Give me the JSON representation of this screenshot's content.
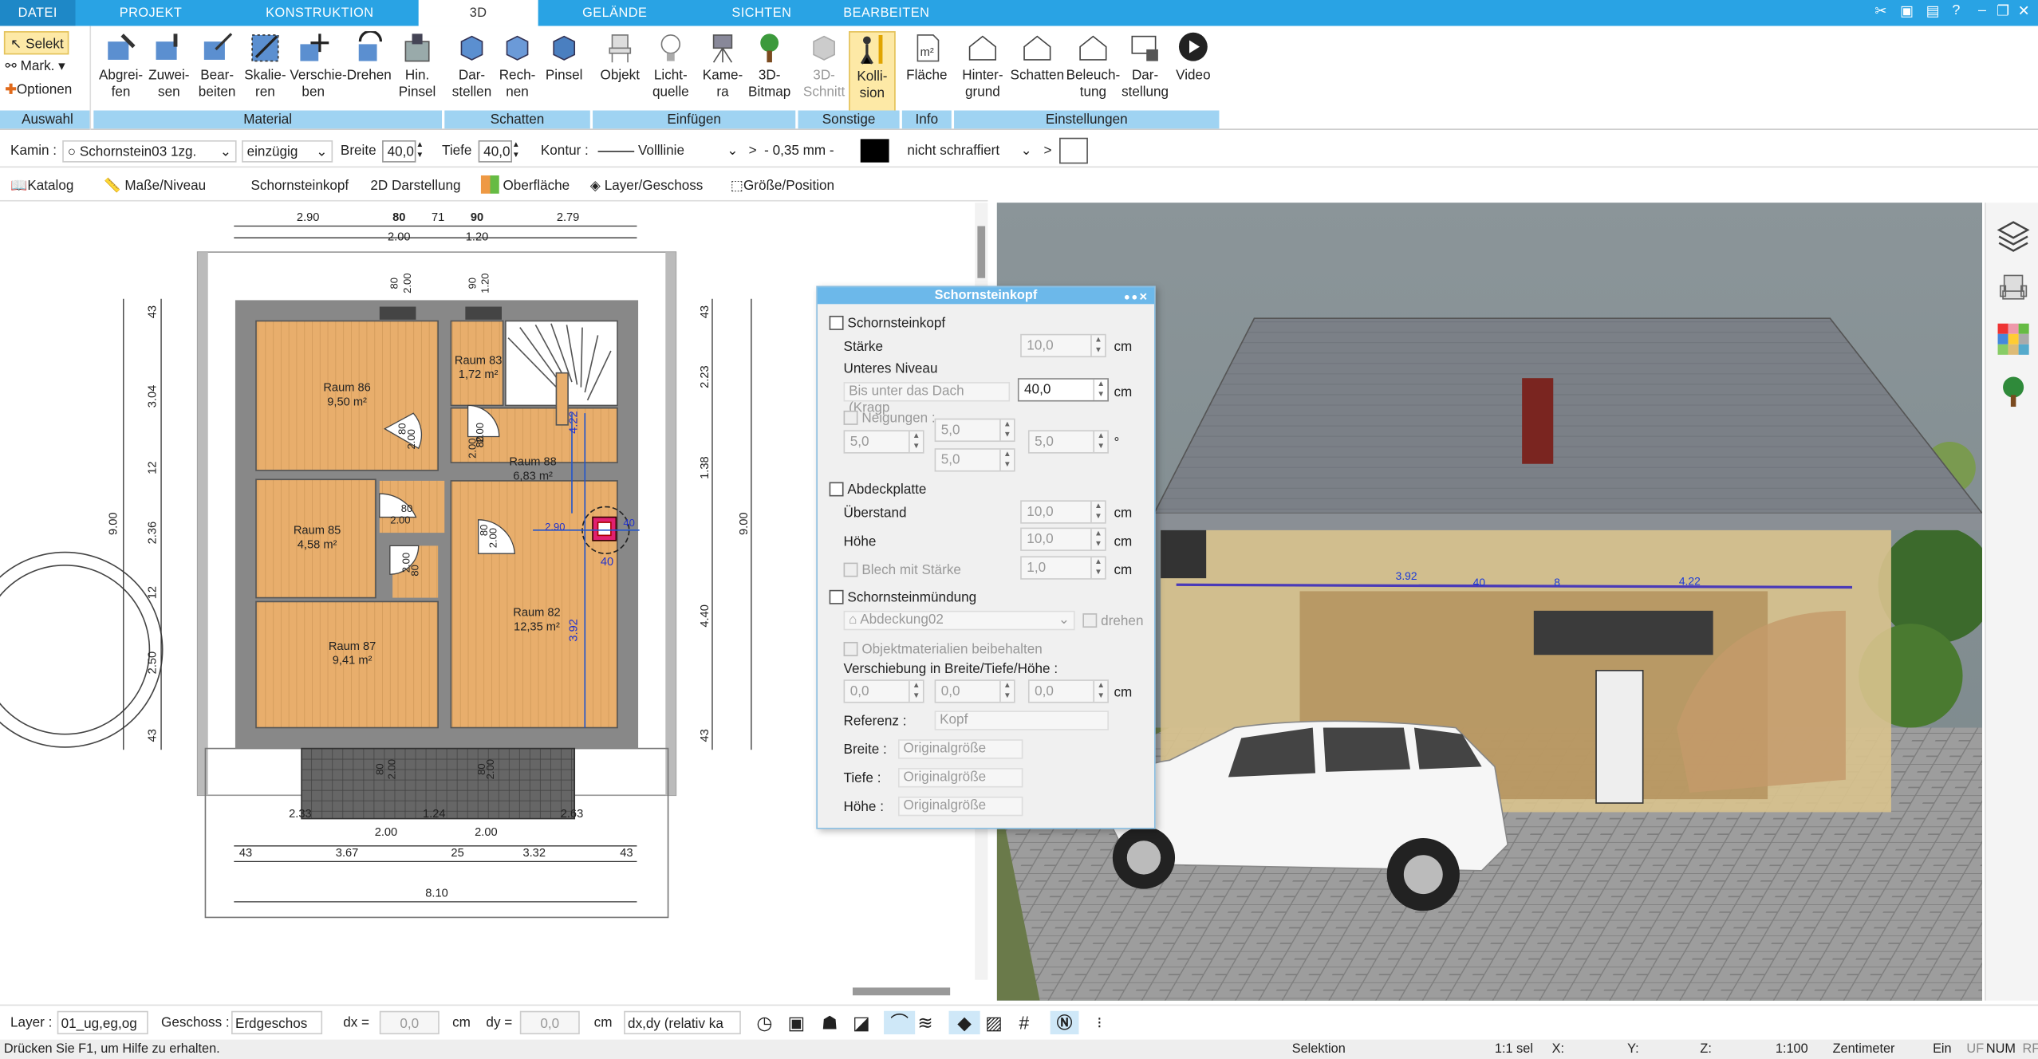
{
  "menu": {
    "tabs": [
      "DATEI",
      "PROJEKT",
      "KONSTRUKTION",
      "3D",
      "GELÄNDE",
      "SICHTEN",
      "BEARBEITEN"
    ]
  },
  "ribbon": {
    "auswahl": {
      "label": "Auswahl",
      "selekt": "Selekt",
      "mark": "Mark.",
      "optionen": "Optionen"
    },
    "material": {
      "label": "Material",
      "buttons": [
        "Abgrei-\nfen",
        "Zuwei-\nsen",
        "Bear-\nbeiten",
        "Skalie-\nren",
        "Verschie-\nben",
        "Drehen",
        "Hin.\nPinsel"
      ]
    },
    "schatten": {
      "label": "Schatten",
      "buttons": [
        "Dar-\nstellen",
        "Rech-\nnen",
        "Pinsel"
      ]
    },
    "einfuegen": {
      "label": "Einfügen",
      "buttons": [
        "Objekt",
        "Licht-\nquelle",
        "Kame-\nra",
        "3D-\nBitmap"
      ]
    },
    "sonstige": {
      "label": "Sonstige",
      "buttons": [
        "3D-\nSchnitt",
        "Kolli-\nsion"
      ]
    },
    "info": {
      "label": "Info",
      "buttons": [
        "Fläche"
      ]
    },
    "einstellungen": {
      "label": "Einstellungen",
      "buttons": [
        "Hinter-\ngrund",
        "Schatten",
        "Beleuch-\ntung",
        "Dar-\nstellung",
        "Video"
      ]
    }
  },
  "propbar": {
    "kamin_label": "Kamin :",
    "kamin_value": "Schornstein03 1zg.",
    "zug": "einzügig",
    "breite_label": "Breite",
    "breite": "40,0",
    "tiefe_label": "Tiefe",
    "tiefe": "40,0",
    "kontur_label": "Kontur :",
    "linie": "Volllinie",
    "gt1": ">",
    "mm": "- 0,35 mm -",
    "schraffur": "nicht schraffiert",
    "gt2": ">"
  },
  "toolbar2": {
    "katalog": "Katalog",
    "masse": "Maße/Niveau",
    "schornsteinkopf": "Schornsteinkopf",
    "darstellung2d": "2D Darstellung",
    "oberflaeche": "Oberfläche",
    "layer": "Layer/Geschoss",
    "groesse": "Größe/Position"
  },
  "plan": {
    "top_dims": [
      "2.90",
      "80",
      "71",
      "90",
      "2.79"
    ],
    "top_dims2": [
      "2.00",
      "1.20"
    ],
    "bottom_dims": [
      "2.33",
      "1.24",
      "2.63"
    ],
    "bottom_dims2": [
      "2.00",
      "2.00"
    ],
    "bottom_dims3": [
      "43",
      "3.67",
      "25",
      "3.32",
      "43"
    ],
    "total": "8.10",
    "left_dims": [
      "43",
      "3.04",
      "12",
      "2.36",
      "12",
      "2.50",
      "43"
    ],
    "left_total": "9.00",
    "right_dims": [
      "43",
      "2.23",
      "1.38",
      "4.40",
      "43"
    ],
    "right_total": "9.00",
    "right_sup": [
      "5",
      "5"
    ],
    "rooms": [
      {
        "name": "Raum 86",
        "area": "9,50 m²"
      },
      {
        "name": "Raum 83",
        "area": "1,72 m²"
      },
      {
        "name": "Raum 88",
        "area": "6,83 m²"
      },
      {
        "name": "Raum 85",
        "area": "4,58 m²"
      },
      {
        "name": "Raum 82",
        "area": "12,35 m²"
      },
      {
        "name": "Raum 87",
        "area": "9,41 m²"
      }
    ],
    "door_labels": [
      "80",
      "2.00",
      "90",
      "1.20",
      "80",
      "2.00",
      "80",
      "2.00",
      "80",
      "2.00",
      "80",
      "2.00",
      "80",
      "2.00",
      "80",
      "2.00",
      "80",
      "2.00",
      "80",
      "2.00"
    ],
    "blue_dims": [
      "4.22",
      "3.92",
      "40",
      "2.90",
      "40"
    ]
  },
  "view3d": {
    "dims": [
      "3.92",
      "40",
      "4.22",
      "8"
    ]
  },
  "dialog": {
    "title": "Schornsteinkopf",
    "cb_schornsteinkopf": "Schornsteinkopf",
    "staerke_label": "Stärke",
    "staerke": "10,0",
    "cm": "cm",
    "unteres_niveau": "Unteres Niveau",
    "niveau_select": "Bis unter das Dach (Kragp",
    "niveau_value": "40,0",
    "neigungen": "Neigungen :",
    "n1": "5,0",
    "n2": "5,0",
    "n3": "5,0",
    "n4": "5,0",
    "deg": "°",
    "cb_abdeckplatte": "Abdeckplatte",
    "ueberstand_label": "Überstand",
    "ueberstand": "10,0",
    "hoehe_label": "Höhe",
    "hoehe": "10,0",
    "blech_label": "Blech mit Stärke",
    "blech": "1,0",
    "cb_muendung": "Schornsteinmündung",
    "abdeckung": "Abdeckung02",
    "drehen": "drehen",
    "objmat": "Objektmaterialien beibehalten",
    "verschiebung": "Verschiebung in Breite/Tiefe/Höhe :",
    "v1": "0,0",
    "v2": "0,0",
    "v3": "0,0",
    "referenz_label": "Referenz :",
    "referenz": "Kopf",
    "breite_label": "Breite :",
    "tiefe_label": "Tiefe :",
    "hoehe2_label": "Höhe :",
    "orig": "Originalgröße"
  },
  "bottombar": {
    "layer_label": "Layer :",
    "layer": "01_ug,eg,og",
    "geschoss_label": "Geschoss :",
    "geschoss": "Erdgeschos",
    "dx_label": "dx =",
    "dx": "0,0",
    "dy_label": "dy =",
    "dy": "0,0",
    "cm": "cm",
    "dxdy": "dx,dy (relativ ka"
  },
  "status": {
    "help": "Drücken Sie F1, um Hilfe zu erhalten.",
    "mode": "Selektion",
    "sel": "1:1 sel",
    "x": "X:",
    "y": "Y:",
    "z": "Z:",
    "scale": "1:100",
    "unit": "Zentimeter",
    "ein": "Ein",
    "uf": "UF",
    "num": "NUM",
    "rf": "RF"
  }
}
